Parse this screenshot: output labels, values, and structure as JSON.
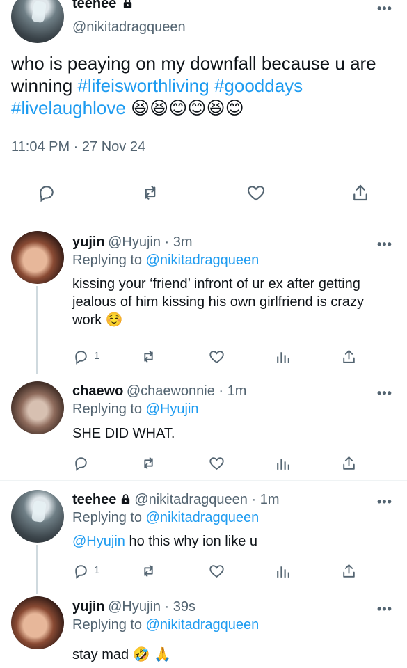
{
  "tweet": {
    "author_name": "teehee",
    "handle": "@nikitadragqueen",
    "text_prefix": "who is peaying on my downfall because u are winning ",
    "hashtags": [
      "#lifeisworthliving",
      "#gooddays",
      "#livelaughlove"
    ],
    "emojis": [
      "😆",
      "😆",
      "😊",
      "😊",
      "😆",
      "😊"
    ],
    "timestamp": "11:04 PM · 27 Nov 24"
  },
  "replies": [
    {
      "name": "yujin",
      "handle_time": "@Hyujin · 3m",
      "replying_label": "Replying to",
      "replying_to": "@nikitadragqueen",
      "text": "kissing your ‘friend’ infront of ur ex after getting jealous of him kissing his own girlfriend is crazy work",
      "emoji": "☺️",
      "reply_count": "1"
    },
    {
      "name": "chaewo",
      "handle_time": "@chaewonnie · 1m",
      "replying_label": "Replying to",
      "replying_to": "@Hyujin",
      "text": "SHE DID WHAT."
    },
    {
      "name": "teehee",
      "handle_time": "@nikitadragqueen · 1m",
      "replying_label": "Replying to",
      "replying_to": "@nikitadragqueen",
      "mention": "@Hyujin",
      "text": "ho this why ion like u",
      "reply_count": "1"
    },
    {
      "name": "yujin",
      "handle_time": "@Hyujin · 39s",
      "replying_label": "Replying to",
      "replying_to": "@nikitadragqueen",
      "text": "stay mad",
      "emojis": [
        "🤣",
        "🙏"
      ]
    }
  ],
  "icons": {
    "more": "more-horizontal-icon",
    "reply": "reply-icon",
    "retweet": "retweet-icon",
    "like": "heart-icon",
    "views": "views-icon",
    "share": "share-icon",
    "lock": "lock-icon"
  },
  "colors": {
    "accent": "#1d9bf0",
    "secondary_text": "#536471",
    "divider": "#eff3f4"
  }
}
